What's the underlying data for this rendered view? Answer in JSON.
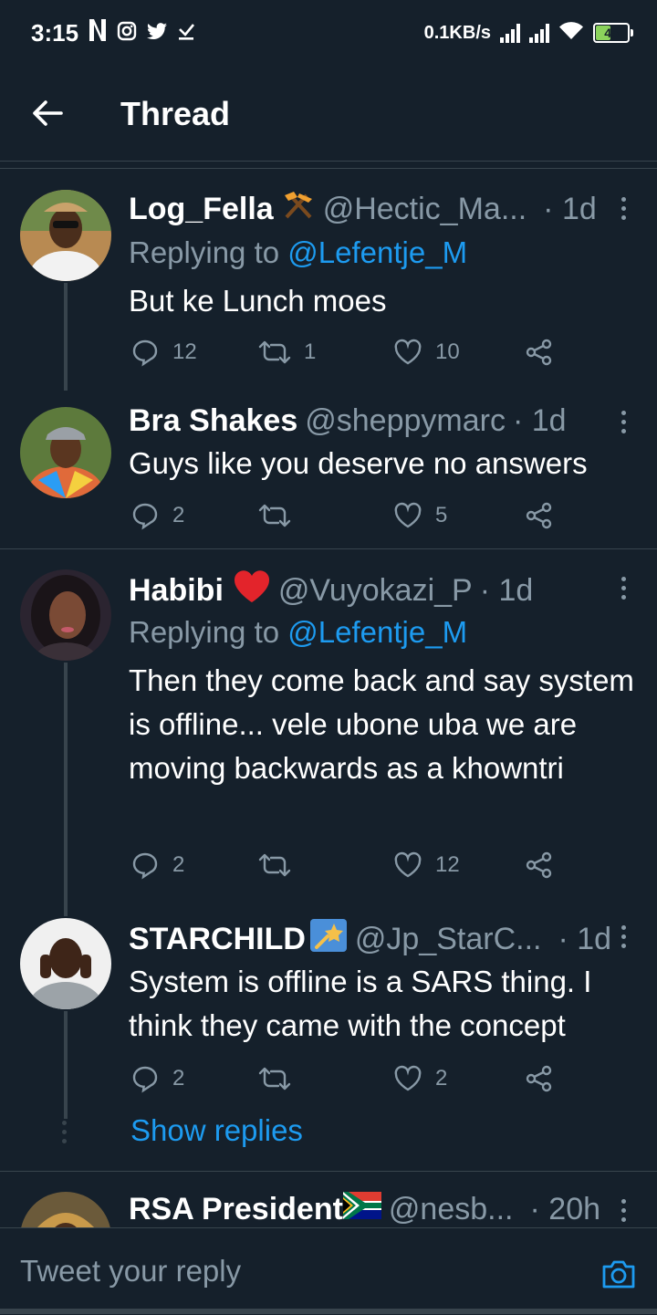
{
  "status_bar": {
    "time": "3:15",
    "network_speed": "0.1KB/s",
    "battery": "45",
    "battery_level": 0.45
  },
  "header": {
    "title": "Thread"
  },
  "tweets": [
    {
      "name": "Log_Fella",
      "name_emoji": "⚒",
      "handle": "@Hectic_Ma...",
      "time": "· 1d",
      "replying_label": "Replying to",
      "replying_to": "@Lefentje_M",
      "text": "But ke Lunch moes",
      "replies": "12",
      "retweets": "1",
      "likes": "10"
    },
    {
      "name": "Bra Shakes",
      "handle": "@sheppymarc",
      "time": "· 1d",
      "text": "Guys like you deserve no answers",
      "replies": "2",
      "retweets": "",
      "likes": "5"
    },
    {
      "name": "Habibi",
      "name_emoji": "❤",
      "handle": "@Vuyokazi_P",
      "time": "· 1d",
      "replying_label": "Replying to",
      "replying_to": "@Lefentje_M",
      "text": "Then they come back and say system is offline... vele ubone uba we are moving backwards as a khowntri",
      "replies": "2",
      "retweets": "",
      "likes": "12"
    },
    {
      "name": "STARCHILD",
      "handle": "@Jp_StarC...",
      "time": "· 1d",
      "text": "System is offline is a SARS thing. I think they came with the concept",
      "replies": "2",
      "retweets": "",
      "likes": "2"
    },
    {
      "name": "RSA President",
      "handle": "@nesb...",
      "time": "· 20h"
    }
  ],
  "show_replies": "Show replies",
  "composer": {
    "placeholder": "Tweet your reply"
  },
  "colors": {
    "background": "#15202b",
    "border": "#38444d",
    "secondary_text": "#8899a6",
    "accent": "#1d9bf0",
    "heart": "#e0245e"
  }
}
